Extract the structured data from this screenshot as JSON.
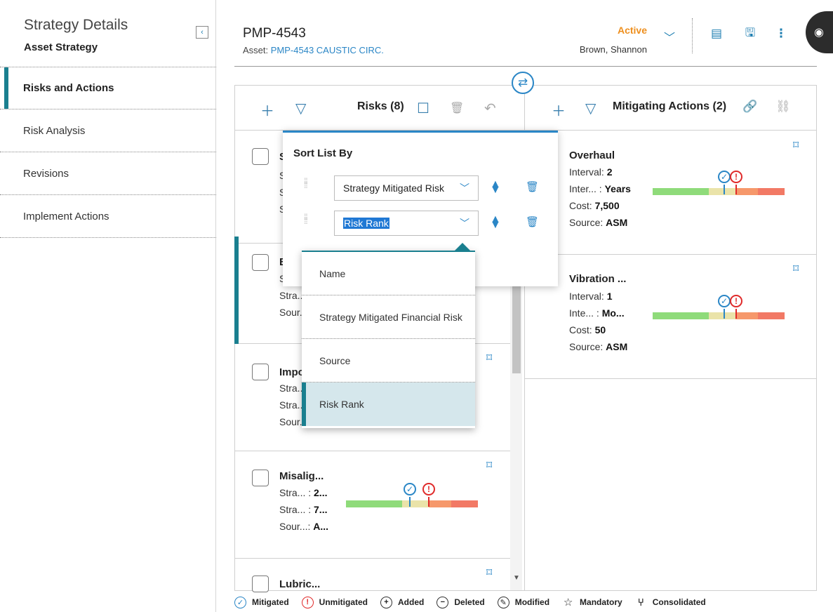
{
  "sidebar": {
    "title": "Strategy Details",
    "subtitle": "Asset Strategy",
    "collapse_icon": "‹",
    "items": [
      {
        "label": "Risks and Actions"
      },
      {
        "label": "Risk Analysis"
      },
      {
        "label": "Revisions"
      },
      {
        "label": "Implement Actions"
      }
    ]
  },
  "header": {
    "title": "PMP-4543",
    "asset_prefix": "Asset:",
    "asset_link": "PMP-4543 CAUSTIC CIRC.",
    "status": "Active",
    "owner": "Brown, Shannon",
    "status_color": "#ee8f1e"
  },
  "risks_panel": {
    "title": "Risks (8)",
    "cards": [
      {
        "name": "S",
        "lines": [
          "S",
          "S",
          "S"
        ]
      },
      {
        "name": "B",
        "lines": [
          "S",
          "Stra...",
          "Sour..."
        ]
      },
      {
        "name": "Impo",
        "lines": [
          "Stra...",
          "Stra...",
          "Sour..."
        ]
      },
      {
        "name": "Misalig...",
        "lines": [
          {
            "label": "Stra... :",
            "value": "2..."
          },
          {
            "label": "Stra... :",
            "value": "7..."
          },
          {
            "label": "Sour...:",
            "value": "A..."
          }
        ]
      },
      {
        "name": "Lubric..."
      }
    ]
  },
  "mitigating_panel": {
    "title": "Mitigating Actions (2)",
    "cards": [
      {
        "name": "Overhaul",
        "lines": [
          {
            "label": "Interval:",
            "value": "2"
          },
          {
            "label": "Inter... :",
            "value": "Years"
          },
          {
            "label": "Cost:",
            "value": "7,500"
          },
          {
            "label": "Source:",
            "value": "ASM"
          }
        ]
      },
      {
        "name": "Vibration ...",
        "lines": [
          {
            "label": "Interval:",
            "value": "1"
          },
          {
            "label": "Inte... :",
            "value": "Mo..."
          },
          {
            "label": "Cost:",
            "value": "50"
          },
          {
            "label": "Source:",
            "value": "ASM"
          }
        ]
      }
    ]
  },
  "sort_popover": {
    "title": "Sort List By",
    "rows": [
      {
        "value": "Strategy Mitigated Risk"
      },
      {
        "value": "Risk Rank"
      }
    ]
  },
  "sort_dropdown": {
    "options": [
      "Name",
      "Strategy Mitigated Financial Risk",
      "Source",
      "Risk Rank"
    ],
    "selected": "Risk Rank"
  },
  "legend": [
    {
      "label": "Mitigated",
      "icon": "check-circle-icon"
    },
    {
      "label": "Unmitigated",
      "icon": "exclamation-circle-icon"
    },
    {
      "label": "Added",
      "icon": "plus-circle-icon"
    },
    {
      "label": "Deleted",
      "icon": "minus-circle-icon"
    },
    {
      "label": "Modified",
      "icon": "pencil-circle-icon"
    },
    {
      "label": "Mandatory",
      "icon": "star-outline-icon"
    },
    {
      "label": "Consolidated",
      "icon": "consolidated-icon"
    }
  ],
  "colors": {
    "accent": "#1a7f8f",
    "link": "#2a86c6",
    "risk_green": "#8fdb7a",
    "risk_yellow": "#eae3a9",
    "risk_orange": "#f6986b",
    "risk_red": "#f27965"
  }
}
